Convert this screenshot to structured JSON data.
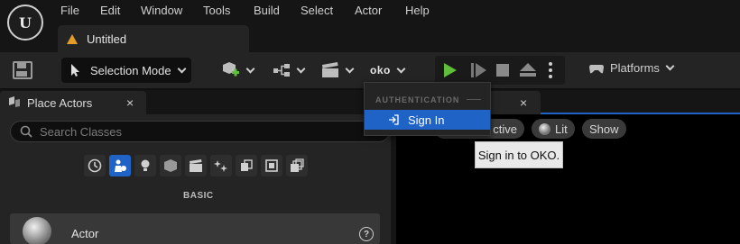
{
  "app": {
    "logo_letter": "U"
  },
  "menu": [
    "File",
    "Edit",
    "Window",
    "Tools",
    "Build",
    "Select",
    "Actor",
    "Help"
  ],
  "document_tab": {
    "label": "Untitled"
  },
  "toolbar": {
    "selection_mode": "Selection Mode",
    "oko_label": "oko",
    "platforms": "Platforms"
  },
  "place_actors": {
    "tab_label": "Place Actors",
    "close": "×",
    "search_placeholder": "Search Classes",
    "section": "BASIC",
    "first_item": "Actor",
    "help": "?"
  },
  "viewport": {
    "close": "×",
    "pills": {
      "perspective_partial": "ctive",
      "lit": "Lit",
      "show": "Show"
    }
  },
  "dropdown": {
    "header": "AUTHENTICATION",
    "item": "Sign In"
  },
  "tooltip": {
    "text": "Sign in to OKO."
  },
  "colors": {
    "accent": "#1f63c6",
    "play": "#5fbf3a",
    "warning": "#e59d2a"
  }
}
